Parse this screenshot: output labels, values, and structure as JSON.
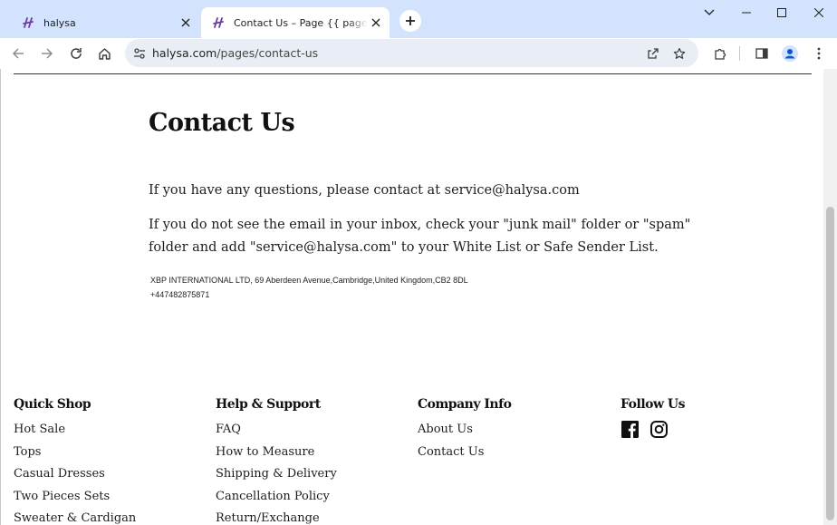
{
  "browser": {
    "tabs": [
      {
        "title": "halysa",
        "active": false
      },
      {
        "title": "Contact Us – Page {{ page }} – halysa",
        "active": true
      }
    ],
    "address": {
      "domain": "halysa.com",
      "path": "/pages/contact-us"
    },
    "colors": {
      "tabstrip": "#d3e3fd",
      "omnibox": "#e9eef6",
      "favicon": "#6b3fa0",
      "profile": "#0b57d0"
    }
  },
  "page": {
    "title": "Contact Us",
    "paragraph_1": "If you have any questions, please contact at service@halysa.com",
    "paragraph_2": "If you do not see the email in your inbox, check your \"junk mail\" folder or \"spam\" folder and add \"service@halysa.com\" to your White List or Safe Sender List.",
    "address": "XBP INTERNATIONAL LTD, 69 Aberdeen Avenue,Cambridge,United Kingdom,CB2 8DL",
    "phone": "+447482875871"
  },
  "footer": {
    "quick_shop": {
      "heading": "Quick Shop",
      "links": [
        "Hot Sale",
        "Tops",
        "Casual Dresses",
        "Two Pieces Sets",
        "Sweater & Cardigan"
      ]
    },
    "help_support": {
      "heading": "Help & Support",
      "links": [
        "FAQ",
        "How to Measure",
        "Shipping & Delivery",
        "Cancellation Policy",
        "Return/Exchange"
      ]
    },
    "company_info": {
      "heading": "Company Info",
      "links": [
        "About Us",
        "Contact Us"
      ]
    },
    "follow_us": {
      "heading": "Follow Us",
      "icons": [
        "facebook-icon",
        "instagram-icon"
      ]
    }
  }
}
